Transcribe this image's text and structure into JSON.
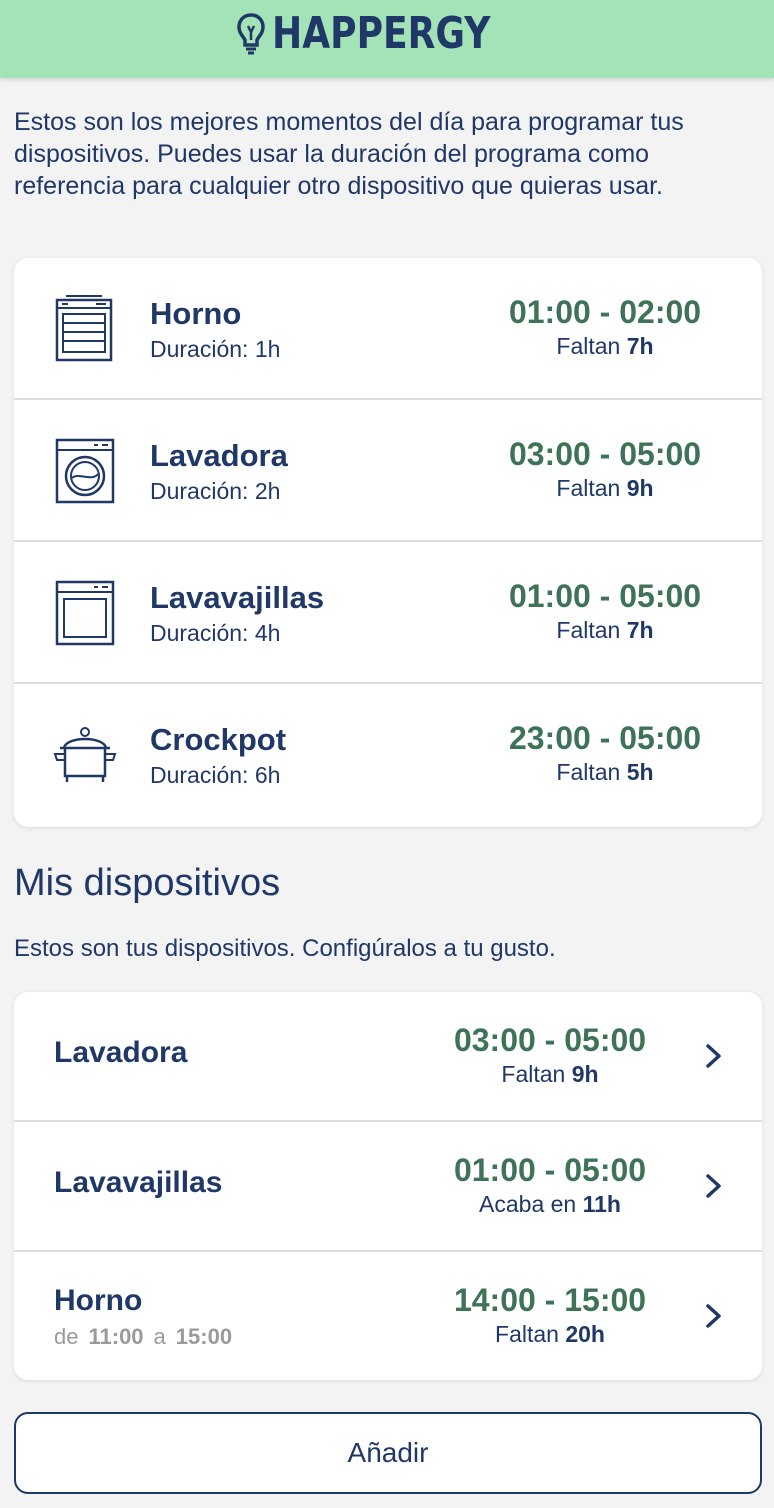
{
  "header": {
    "logo_text": "HAPPERGY",
    "logo_icon": "lightbulb-icon"
  },
  "intro": "Estos son los mejores momentos del día para programar tus dispositivos. Puedes usar la duración del programa como referencia para cualquier otro dispositivo que quieras usar.",
  "recommendations": [
    {
      "icon": "oven-icon",
      "name": "Horno",
      "duration": "Duración: 1h",
      "time": "01:00 - 02:00",
      "remain_label": "Faltan",
      "remain_value": "7h"
    },
    {
      "icon": "washing-machine-icon",
      "name": "Lavadora",
      "duration": "Duración: 2h",
      "time": "03:00 - 05:00",
      "remain_label": "Faltan",
      "remain_value": "9h"
    },
    {
      "icon": "dishwasher-icon",
      "name": "Lavavajillas",
      "duration": "Duración: 4h",
      "time": "01:00 - 05:00",
      "remain_label": "Faltan",
      "remain_value": "7h"
    },
    {
      "icon": "crockpot-icon",
      "name": "Crockpot",
      "duration": "Duración: 6h",
      "time": "23:00 - 05:00",
      "remain_label": "Faltan",
      "remain_value": "5h"
    }
  ],
  "my_devices": {
    "title": "Mis dispositivos",
    "subtitle": "Estos son tus dispositivos. Configúralos a tu gusto.",
    "items": [
      {
        "name": "Lavadora",
        "time": "03:00 - 05:00",
        "remain_label": "Faltan",
        "remain_value": "9h"
      },
      {
        "name": "Lavavajillas",
        "time": "01:00 - 05:00",
        "remain_label": "Acaba en",
        "remain_value": "11h"
      },
      {
        "name": "Horno",
        "range_from_label": "de",
        "range_from": "11:00",
        "range_to_label": "a",
        "range_to": "15:00",
        "time": "14:00 - 15:00",
        "remain_label": "Faltan",
        "remain_value": "20h"
      }
    ]
  },
  "add_button": "Añadir",
  "colors": {
    "header_bg": "#a4e3b7",
    "primary": "#1f3868",
    "time_green": "#3e7358",
    "page_bg": "#f3f3f3"
  }
}
